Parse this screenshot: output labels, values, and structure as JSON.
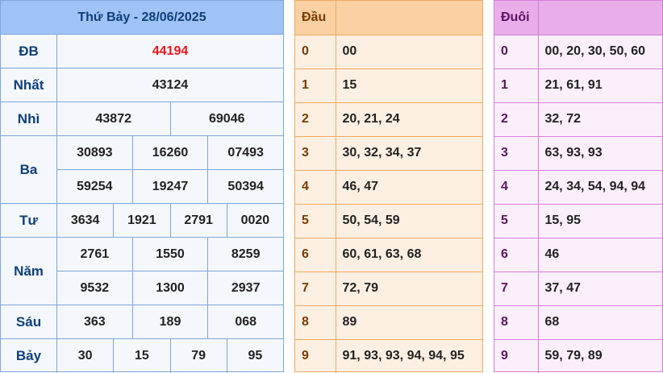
{
  "title": "Thứ Bảy - 28/06/2025",
  "prizes": [
    {
      "label": "ĐB",
      "lines": [
        [
          "44194"
        ]
      ],
      "special": true
    },
    {
      "label": "Nhất",
      "lines": [
        [
          "43124"
        ]
      ]
    },
    {
      "label": "Nhì",
      "lines": [
        [
          "43872",
          "69046"
        ]
      ]
    },
    {
      "label": "Ba",
      "lines": [
        [
          "30893",
          "16260",
          "07493"
        ],
        [
          "59254",
          "19247",
          "50394"
        ]
      ]
    },
    {
      "label": "Tư",
      "lines": [
        [
          "3634",
          "1921",
          "2791",
          "0020"
        ]
      ]
    },
    {
      "label": "Năm",
      "lines": [
        [
          "2761",
          "1550",
          "8259"
        ],
        [
          "9532",
          "1300",
          "2937"
        ]
      ]
    },
    {
      "label": "Sáu",
      "lines": [
        [
          "363",
          "189",
          "068"
        ]
      ]
    },
    {
      "label": "Bảy",
      "lines": [
        [
          "30",
          "15",
          "79",
          "95"
        ]
      ]
    }
  ],
  "dau": {
    "header": "Đầu",
    "rows": [
      {
        "key": "0",
        "value": "00"
      },
      {
        "key": "1",
        "value": "15"
      },
      {
        "key": "2",
        "value": "20, 21, 24"
      },
      {
        "key": "3",
        "value": "30, 32, 34, 37"
      },
      {
        "key": "4",
        "value": "46, 47"
      },
      {
        "key": "5",
        "value": "50, 54, 59"
      },
      {
        "key": "6",
        "value": "60, 61, 63, 68"
      },
      {
        "key": "7",
        "value": "72, 79"
      },
      {
        "key": "8",
        "value": "89"
      },
      {
        "key": "9",
        "value": "91, 93, 93, 94, 94, 95"
      }
    ]
  },
  "duoi": {
    "header": "Đuôi",
    "rows": [
      {
        "key": "0",
        "value": "00, 20, 30, 50, 60"
      },
      {
        "key": "1",
        "value": "21, 61, 91"
      },
      {
        "key": "2",
        "value": "32, 72"
      },
      {
        "key": "3",
        "value": "63, 93, 93"
      },
      {
        "key": "4",
        "value": "24, 34, 54, 94, 94"
      },
      {
        "key": "5",
        "value": "15, 95"
      },
      {
        "key": "6",
        "value": "46"
      },
      {
        "key": "7",
        "value": "37, 47"
      },
      {
        "key": "8",
        "value": "68"
      },
      {
        "key": "9",
        "value": "59, 79, 89"
      }
    ]
  },
  "colors": {
    "title_bg": "#9fc3f7",
    "special_number": "#e8161b",
    "dau_header_bg": "#fbd0a2",
    "duoi_header_bg": "#e9aee9"
  }
}
